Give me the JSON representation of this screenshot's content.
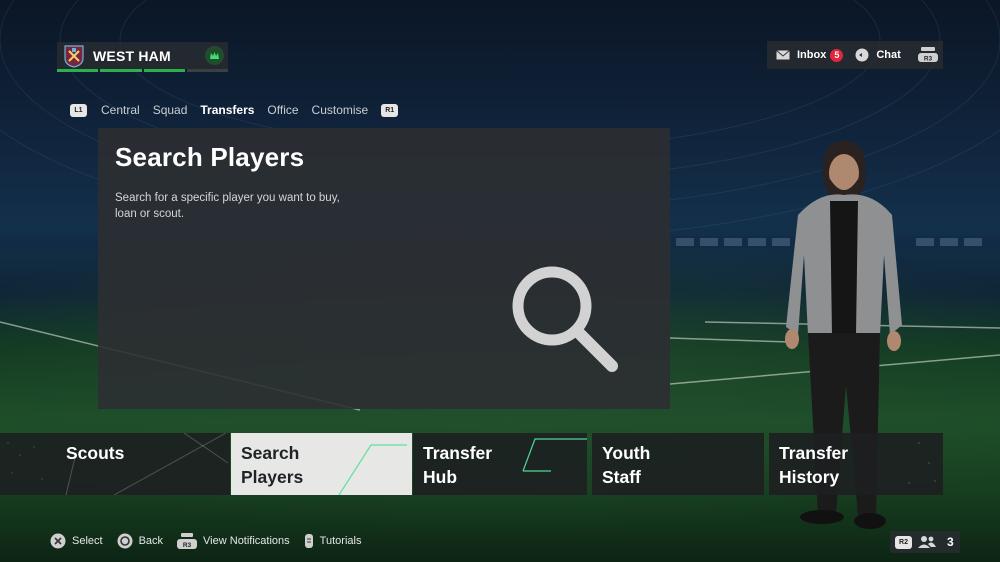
{
  "club": {
    "name": "WEST HAM"
  },
  "topbar": {
    "inbox_label": "Inbox",
    "inbox_count": "5",
    "chat_label": "Chat",
    "r3_hint": "R3"
  },
  "tabs": {
    "l1": "L1",
    "r1": "R1",
    "items": [
      "Central",
      "Squad",
      "Transfers",
      "Office",
      "Customise"
    ],
    "active": "Transfers"
  },
  "card": {
    "title": "Search Players",
    "description": "Search for a specific player you want to buy, loan or scout."
  },
  "tiles": [
    {
      "line1": "Scouts",
      "line2": ""
    },
    {
      "line1": "Search",
      "line2": "Players"
    },
    {
      "line1": "Transfer",
      "line2": "Hub"
    },
    {
      "line1": "Youth",
      "line2": "Staff"
    },
    {
      "line1": "Transfer",
      "line2": "History"
    }
  ],
  "hints": {
    "select": "Select",
    "back": "Back",
    "view_notifications": "View Notifications",
    "tutorials": "Tutorials",
    "r3": "R3"
  },
  "bottom_right": {
    "r2": "R2",
    "count": "3"
  },
  "colors": {
    "accent_green": "#2fae4e",
    "badge_red": "#e2263b",
    "selected_tile": "#e7e8e6"
  }
}
